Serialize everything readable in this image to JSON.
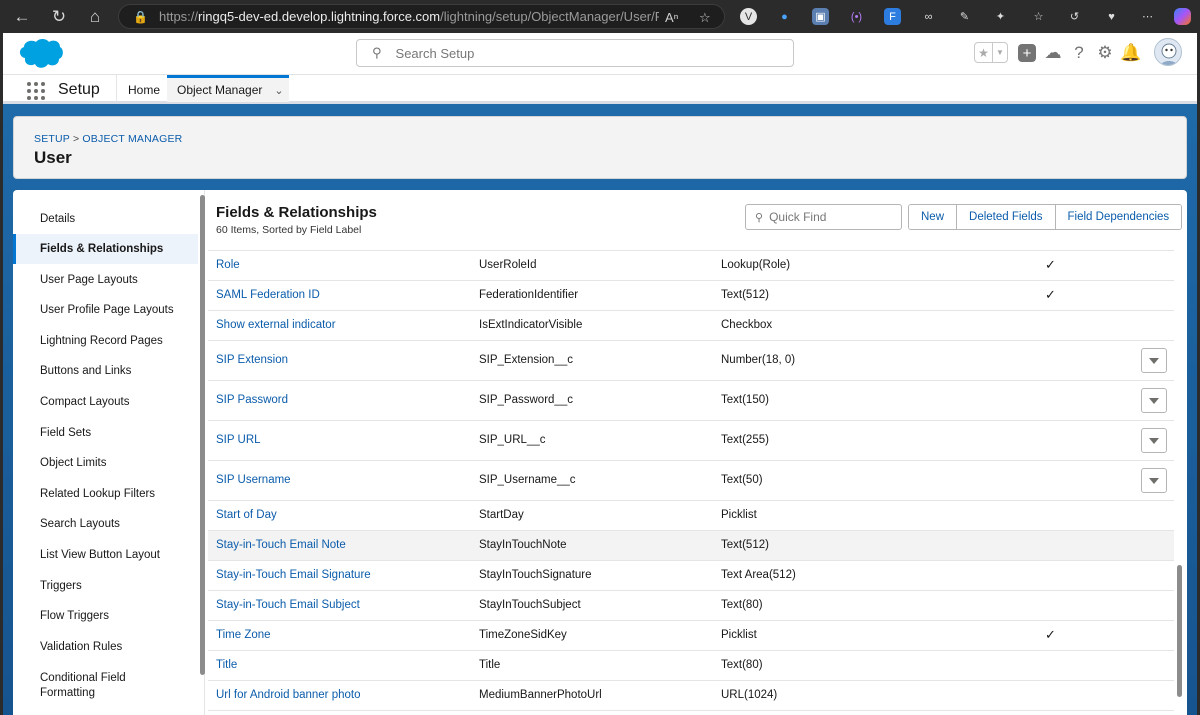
{
  "browser": {
    "url_prefix": "https://",
    "url_host": "ringq5-dev-ed.develop.lightning.force.com",
    "url_path": "/lightning/setup/ObjectManager/User/Fi..."
  },
  "header": {
    "search_placeholder": "Search Setup"
  },
  "nav": {
    "app_name": "Setup",
    "home_label": "Home",
    "active_tab_label": "Object Manager"
  },
  "page": {
    "breadcrumb_setup": "SETUP",
    "breadcrumb_sep": ">",
    "breadcrumb_object_manager": "OBJECT MANAGER",
    "title": "User"
  },
  "sidebar": {
    "items": [
      {
        "label": "Details"
      },
      {
        "label": "Fields & Relationships",
        "active": true
      },
      {
        "label": "User Page Layouts"
      },
      {
        "label": "User Profile Page Layouts"
      },
      {
        "label": "Lightning Record Pages"
      },
      {
        "label": "Buttons and Links"
      },
      {
        "label": "Compact Layouts"
      },
      {
        "label": "Field Sets"
      },
      {
        "label": "Object Limits"
      },
      {
        "label": "Related Lookup Filters"
      },
      {
        "label": "Search Layouts"
      },
      {
        "label": "List View Button Layout"
      },
      {
        "label": "Triggers"
      },
      {
        "label": "Flow Triggers"
      },
      {
        "label": "Validation Rules"
      },
      {
        "label": "Conditional Field Formatting"
      }
    ]
  },
  "fields_panel": {
    "title": "Fields & Relationships",
    "subtitle": "60 Items, Sorted by Field Label",
    "quick_find_placeholder": "Quick Find",
    "buttons": {
      "new": "New",
      "deleted_fields": "Deleted Fields",
      "field_dependencies": "Field Dependencies"
    }
  },
  "rows": [
    {
      "label": "Role",
      "api": "UserRoleId",
      "type": "Lookup(Role)",
      "indexed": "✓",
      "menu": false
    },
    {
      "label": "SAML Federation ID",
      "api": "FederationIdentifier",
      "type": "Text(512)",
      "indexed": "✓",
      "menu": false
    },
    {
      "label": "Show external indicator",
      "api": "IsExtIndicatorVisible",
      "type": "Checkbox",
      "indexed": "",
      "menu": false
    },
    {
      "label": "SIP Extension",
      "api": "SIP_Extension__c",
      "type": "Number(18, 0)",
      "indexed": "",
      "menu": true
    },
    {
      "label": "SIP Password",
      "api": "SIP_Password__c",
      "type": "Text(150)",
      "indexed": "",
      "menu": true
    },
    {
      "label": "SIP URL",
      "api": "SIP_URL__c",
      "type": "Text(255)",
      "indexed": "",
      "menu": true
    },
    {
      "label": "SIP Username",
      "api": "SIP_Username__c",
      "type": "Text(50)",
      "indexed": "",
      "menu": true
    },
    {
      "label": "Start of Day",
      "api": "StartDay",
      "type": "Picklist",
      "indexed": "",
      "menu": false
    },
    {
      "label": "Stay-in-Touch Email Note",
      "api": "StayInTouchNote",
      "type": "Text(512)",
      "indexed": "",
      "menu": false,
      "hover": true
    },
    {
      "label": "Stay-in-Touch Email Signature",
      "api": "StayInTouchSignature",
      "type": "Text Area(512)",
      "indexed": "",
      "menu": false
    },
    {
      "label": "Stay-in-Touch Email Subject",
      "api": "StayInTouchSubject",
      "type": "Text(80)",
      "indexed": "",
      "menu": false
    },
    {
      "label": "Time Zone",
      "api": "TimeZoneSidKey",
      "type": "Picklist",
      "indexed": "✓",
      "menu": false
    },
    {
      "label": "Title",
      "api": "Title",
      "type": "Text(80)",
      "indexed": "",
      "menu": false
    },
    {
      "label": "Url for Android banner photo",
      "api": "MediumBannerPhotoUrl",
      "type": "URL(1024)",
      "indexed": "",
      "menu": false
    }
  ],
  "colors": {
    "brand_blue": "#0176d3",
    "link_blue": "#0b5cab",
    "page_bg": "#1b5f9e"
  }
}
